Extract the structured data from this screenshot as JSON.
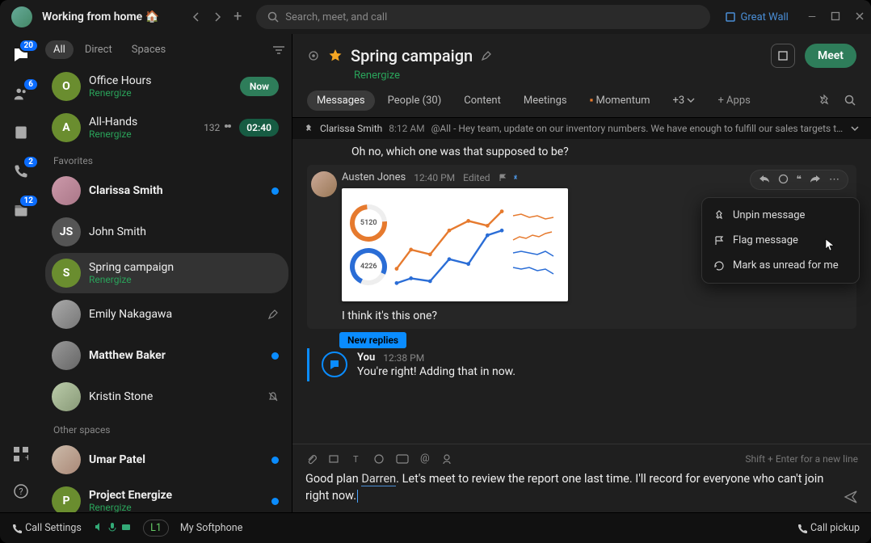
{
  "titlebar": {
    "status": "Working from home 🏠",
    "search_placeholder": "Search, meet, and call",
    "org": "Great Wall"
  },
  "rail": {
    "badges": {
      "chat": "20",
      "teams": "6",
      "phone": "2",
      "calendar": "12"
    }
  },
  "sidebar": {
    "tabs": {
      "all": "All",
      "direct": "Direct",
      "spaces": "Spaces"
    },
    "items": [
      {
        "name": "Office Hours",
        "sub": "Renergize",
        "initial": "O",
        "color": "#6a8d2f",
        "right": "now"
      },
      {
        "name": "All-Hands",
        "sub": "Renergize",
        "initial": "A",
        "color": "#6a8d2f",
        "count": "132",
        "time": "02:40"
      }
    ],
    "section_favorites": "Favorites",
    "favorites": [
      {
        "name": "Clarissa Smith",
        "bold": true,
        "unread": true,
        "presence": "active"
      },
      {
        "name": "John Smith",
        "initial": "JS",
        "color": "#555"
      },
      {
        "name": "Spring campaign",
        "sub": "Renergize",
        "initial": "S",
        "color": "#6a8d2f",
        "selected": true
      },
      {
        "name": "Emily Nakagawa",
        "unread": true,
        "draft": true
      },
      {
        "name": "Matthew Baker",
        "bold": true,
        "unread": true,
        "presence": "dnd"
      },
      {
        "name": "Kristin Stone",
        "presence": "active",
        "muted": true
      }
    ],
    "section_other": "Other spaces",
    "other": [
      {
        "name": "Umar Patel",
        "bold": true,
        "unread": true
      },
      {
        "name": "Project Energize",
        "sub": "Renergize",
        "initial": "P",
        "color": "#6a8d2f",
        "unread": true
      }
    ]
  },
  "header": {
    "title": "Spring campaign",
    "sub": "Renergize",
    "meet": "Meet"
  },
  "tabs": {
    "messages": "Messages",
    "people": "People (30)",
    "content": "Content",
    "meetings": "Meetings",
    "momentum": "Momentum",
    "more": "+3",
    "apps": "+ Apps"
  },
  "pinbar": {
    "author": "Clarissa Smith",
    "time": "8:12 AM",
    "text": "@All - Hey team, update on our inventory numbers. We have enough to fulfill our sales targets this mon…"
  },
  "messages": {
    "first": {
      "text": "Oh no, which one was that supposed to be?"
    },
    "pinned": {
      "author": "Austen Jones",
      "time": "12:40 PM",
      "edited": "Edited",
      "caption": "I think it's this one?"
    },
    "new_replies": "New replies",
    "reply": {
      "author": "You",
      "time": "12:38 PM",
      "text": "You're right! Adding that in now."
    }
  },
  "context_menu": {
    "unpin": "Unpin message",
    "flag": "Flag message",
    "unread": "Mark as unread for me"
  },
  "composer": {
    "hint": "Shift + Enter for a new line",
    "text_pre": "Good plan ",
    "mention": "Darren",
    "text_post": ". Let's meet to review the report one last time. I'll record for everyone who can't join right now."
  },
  "footer": {
    "call_settings": "Call Settings",
    "softphone_badge": "L1",
    "softphone": "My Softphone",
    "pickup": "Call pickup"
  },
  "chart_data": {
    "type": "mixed",
    "donuts": [
      {
        "value": 5120,
        "color": "#e67a2e"
      },
      {
        "value": 4226,
        "color": "#2a6dd6"
      }
    ],
    "line": {
      "x": [
        1,
        2,
        3,
        4,
        5,
        6,
        7
      ],
      "series": [
        {
          "name": "orange",
          "values": [
            4,
            7,
            6,
            10,
            12,
            11,
            13
          ],
          "color": "#e67a2e"
        },
        {
          "name": "blue",
          "values": [
            2,
            3,
            2,
            5,
            4,
            8,
            9
          ],
          "color": "#2a6dd6"
        }
      ],
      "ylim": [
        0,
        14
      ]
    },
    "sparklines": [
      {
        "values": [
          12,
          13,
          11,
          12,
          10,
          11
        ],
        "color": "#e67a2e"
      },
      {
        "values": [
          6,
          8,
          7,
          9,
          8,
          10,
          11,
          12
        ],
        "color": "#e67a2e"
      },
      {
        "values": [
          4,
          5,
          4,
          3,
          5,
          4,
          3,
          2
        ],
        "color": "#2a6dd6"
      },
      {
        "values": [
          8,
          7,
          8,
          6,
          7,
          5,
          6,
          4
        ],
        "color": "#2a6dd6"
      }
    ]
  }
}
